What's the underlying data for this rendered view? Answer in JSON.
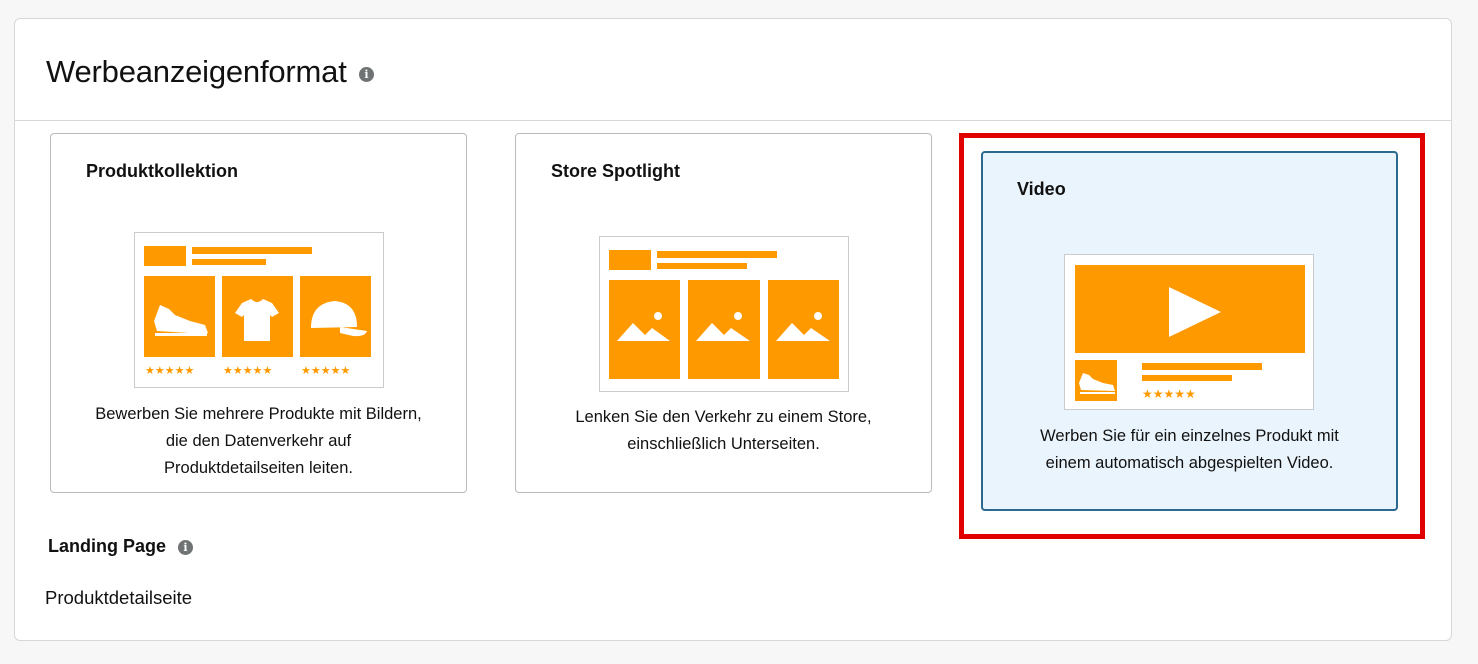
{
  "section": {
    "title": "Werbeanzeigenformat"
  },
  "formats": [
    {
      "title": "Produktkollektion",
      "description_lines": [
        "Bewerben Sie mehrere Produkte mit Bildern,",
        "die den Datenverkehr auf",
        "Produktdetailseiten leiten."
      ],
      "selected": false,
      "image": "product-collection-illustration"
    },
    {
      "title": "Store Spotlight",
      "description_lines": [
        "Lenken Sie den Verkehr zu einem Store,",
        "einschließlich Unterseiten."
      ],
      "selected": false,
      "image": "store-spotlight-illustration"
    },
    {
      "title": "Video",
      "description_lines": [
        "Werben Sie für ein einzelnes Produkt mit",
        "einem automatisch abgespielten Video."
      ],
      "selected": true,
      "image": "video-illustration"
    }
  ],
  "landing_page": {
    "label": "Landing Page",
    "value": "Produktdetailseite"
  },
  "icons": {
    "info": "info-icon",
    "info_glyph": "i"
  },
  "colors": {
    "accent_orange": "#ff9900",
    "selected_background": "#eaf4fd",
    "selected_border": "#2b6a8e",
    "highlight_red": "#e00000"
  }
}
